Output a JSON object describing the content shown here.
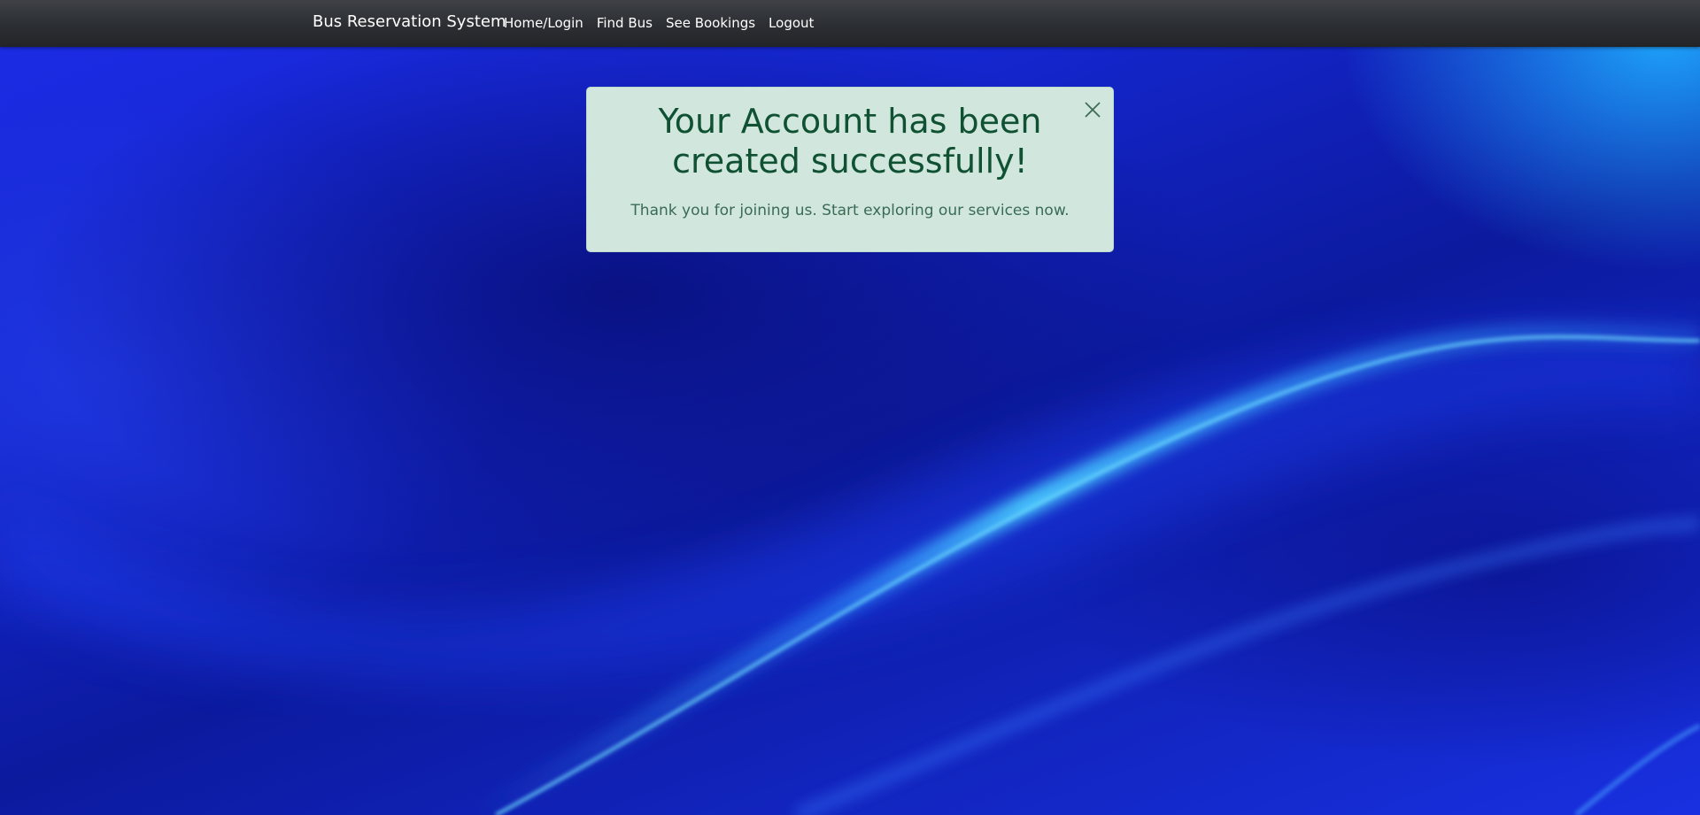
{
  "app": {
    "brand": "Bus Reservation System"
  },
  "nav": {
    "links": [
      {
        "label": "Home/Login"
      },
      {
        "label": "Find Bus"
      },
      {
        "label": "See Bookings"
      },
      {
        "label": "Logout"
      }
    ]
  },
  "alert": {
    "heading": "Your Account has been created successfully!",
    "message": "Thank you for joining us. Start exploring our services now.",
    "close_icon": "close-icon",
    "background": "#d1e7dd",
    "text_color": "#0f5132"
  },
  "theme": {
    "navbar_color": "#343a40",
    "background_accent": "#1a22d8"
  }
}
